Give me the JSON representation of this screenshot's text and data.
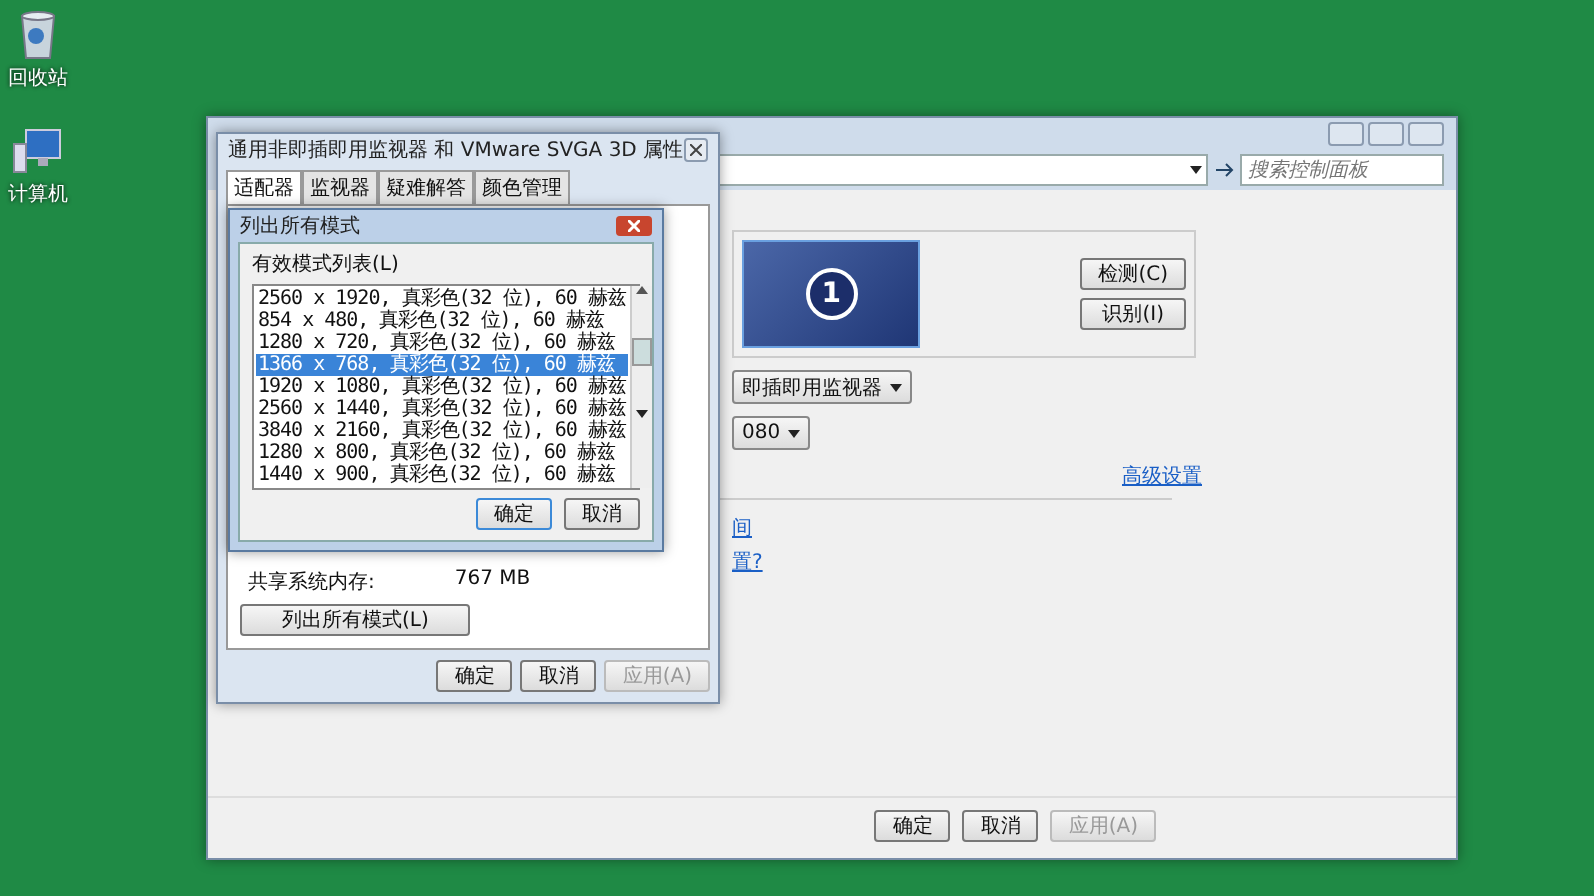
{
  "desktop": {
    "icons": [
      {
        "label": "回收站",
        "kind": "recycle-bin"
      },
      {
        "label": "计算机",
        "kind": "computer"
      }
    ]
  },
  "control_panel": {
    "search": {
      "placeholder": "搜索控制面板"
    },
    "display_number": "1",
    "side_buttons": [
      "检测(C)",
      "识别(I)"
    ],
    "display_dropdown": "即插即用监视器",
    "resolution_dropdown": "080",
    "advanced_link": "高级设置",
    "links": [
      "间",
      "置?"
    ],
    "footer_buttons": [
      {
        "label": "确定",
        "disabled": false
      },
      {
        "label": "取消",
        "disabled": false
      },
      {
        "label": "应用(A)",
        "disabled": true
      }
    ]
  },
  "properties_dialog": {
    "title": "通用非即插即用监视器 和 VMware SVGA 3D 属性",
    "tabs": [
      {
        "label": "适配器",
        "selected": true
      },
      {
        "label": "监视器",
        "selected": false
      },
      {
        "label": "疑难解答",
        "selected": false
      },
      {
        "label": "颜色管理",
        "selected": false
      }
    ],
    "shared_memory_label": "共享系统内存:",
    "shared_memory_value": "767 MB",
    "list_modes_button": "列出所有模式(L)",
    "footer_buttons": [
      {
        "label": "确定",
        "disabled": false
      },
      {
        "label": "取消",
        "disabled": false
      },
      {
        "label": "应用(A)",
        "disabled": true
      }
    ]
  },
  "modes_dialog": {
    "title": "列出所有模式",
    "list_label": "有效模式列表(L)",
    "modes": [
      {
        "label": "2560 x 1920, 真彩色(32 位), 60 赫兹",
        "selected": false
      },
      {
        "label": "854 x 480, 真彩色(32 位), 60 赫兹",
        "selected": false
      },
      {
        "label": "1280 x 720, 真彩色(32 位), 60 赫兹",
        "selected": false
      },
      {
        "label": "1366 x 768, 真彩色(32 位), 60 赫兹",
        "selected": true
      },
      {
        "label": "1920 x 1080, 真彩色(32 位), 60 赫兹",
        "selected": false
      },
      {
        "label": "2560 x 1440, 真彩色(32 位), 60 赫兹",
        "selected": false
      },
      {
        "label": "3840 x 2160, 真彩色(32 位), 60 赫兹",
        "selected": false
      },
      {
        "label": "1280 x 800, 真彩色(32 位), 60 赫兹",
        "selected": false
      },
      {
        "label": "1440 x 900, 真彩色(32 位), 60 赫兹",
        "selected": false
      }
    ],
    "buttons": [
      "确定",
      "取消"
    ]
  }
}
